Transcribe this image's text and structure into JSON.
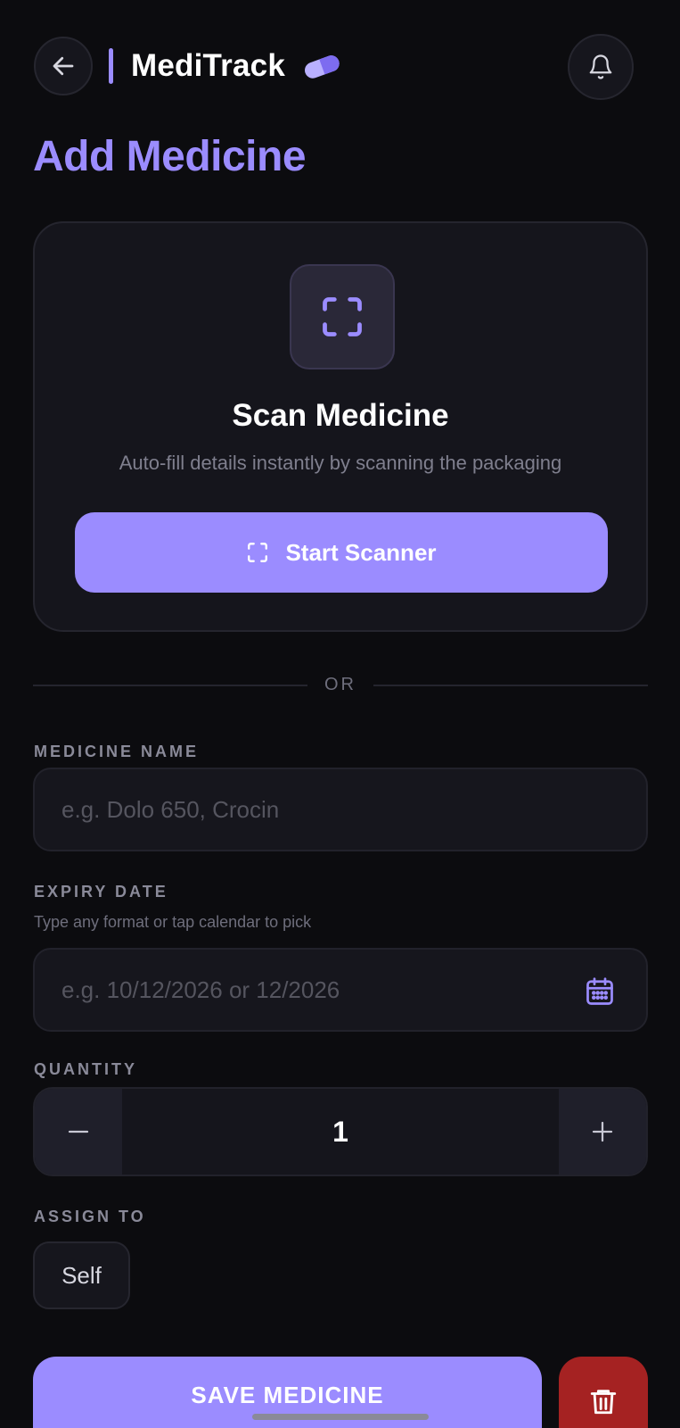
{
  "header": {
    "app_title": "MediTrack",
    "back_icon": "arrow-left-icon",
    "brand_icon": "pill-icon",
    "notification_icon": "bell-icon"
  },
  "page_title": "Add Medicine",
  "scan_card": {
    "icon": "scan-frame-icon",
    "title": "Scan Medicine",
    "subtitle": "Auto-fill details instantly by scanning the packaging",
    "button_label": "Start Scanner"
  },
  "divider_text": "OR",
  "medicine_name": {
    "label": "MEDICINE NAME",
    "value": "",
    "placeholder": "e.g. Dolo 650, Crocin"
  },
  "expiry_date": {
    "label": "EXPIRY DATE",
    "hint": "Type any format or tap calendar to pick",
    "value": "",
    "placeholder": "e.g. 10/12/2026 or 12/2026",
    "icon": "calendar-icon"
  },
  "quantity": {
    "label": "QUANTITY",
    "value": "1"
  },
  "assign_to": {
    "label": "ASSIGN TO",
    "selected": "Self"
  },
  "actions": {
    "save_label": "SAVE MEDICINE",
    "delete_icon": "trash-icon"
  },
  "colors": {
    "accent": "#9b8cff",
    "background": "#0c0c0f",
    "card": "#15151c",
    "danger": "#a52222"
  }
}
